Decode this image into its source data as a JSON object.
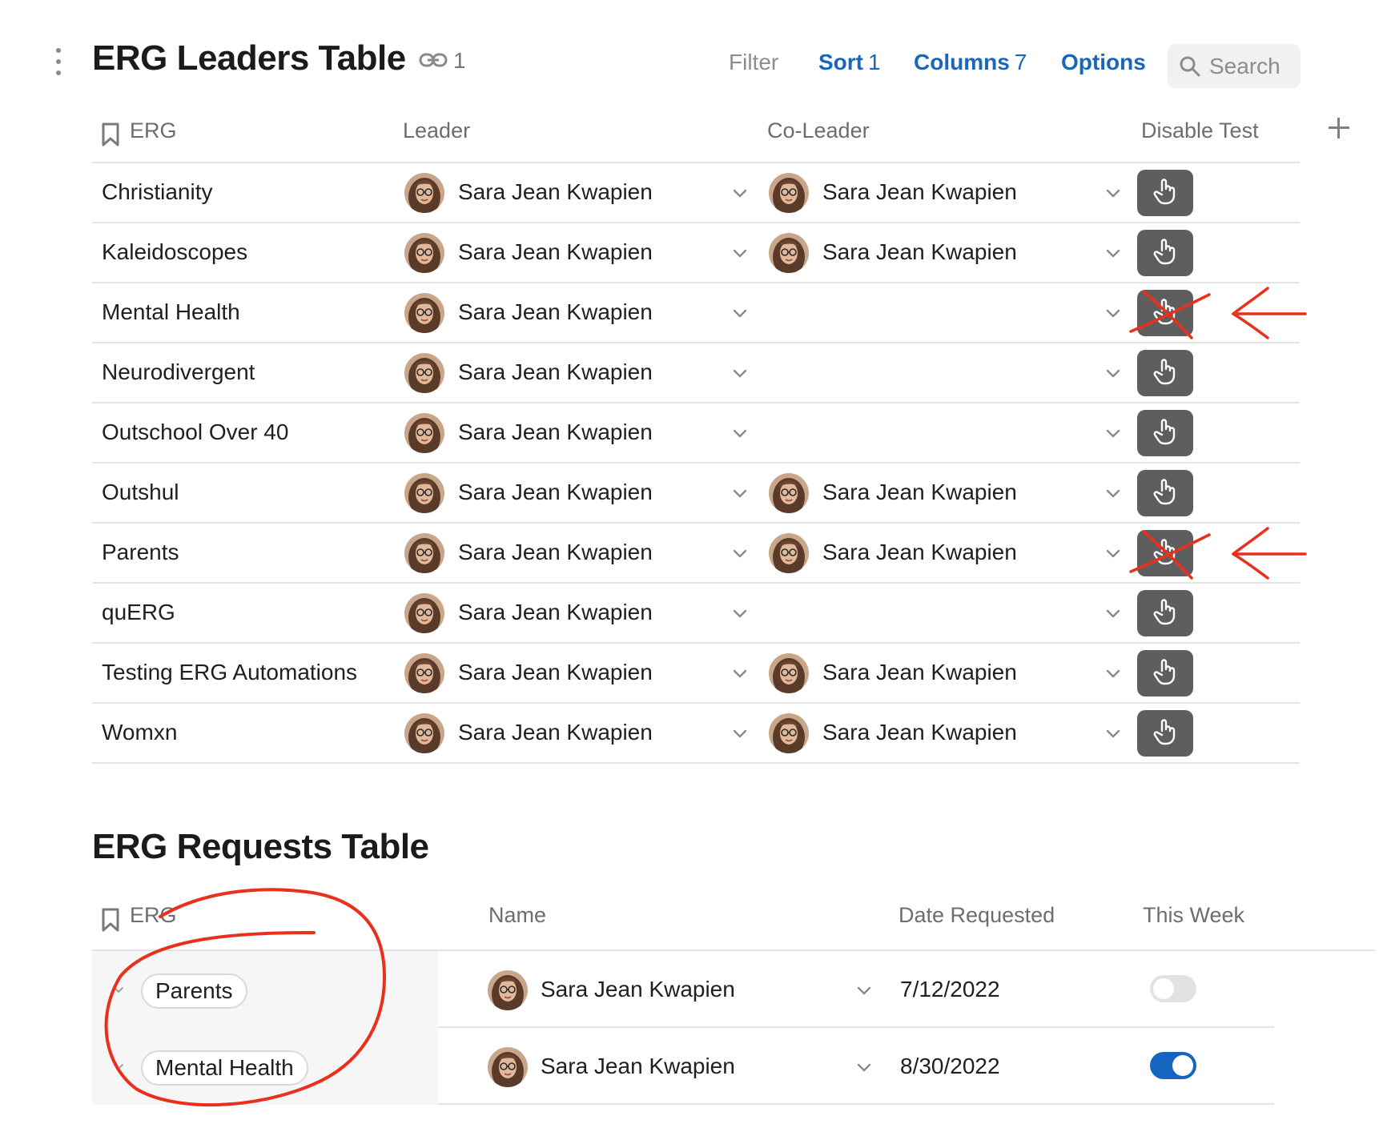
{
  "leaders_table": {
    "title": "ERG Leaders Table",
    "link_count": "1",
    "toolbar": {
      "filter": "Filter",
      "sort": "Sort",
      "sort_count": "1",
      "columns": "Columns",
      "columns_count": "7",
      "options": "Options",
      "search_placeholder": "Search"
    },
    "columns": [
      "ERG",
      "Leader",
      "Co-Leader",
      "Disable Test"
    ],
    "rows": [
      {
        "erg": "Christianity",
        "leader": "Sara Jean Kwapien",
        "co_leader": "Sara Jean Kwapien",
        "crossed_out": false
      },
      {
        "erg": "Kaleidoscopes",
        "leader": "Sara Jean Kwapien",
        "co_leader": "Sara Jean Kwapien",
        "crossed_out": false
      },
      {
        "erg": "Mental Health",
        "leader": "Sara Jean Kwapien",
        "co_leader": "",
        "crossed_out": true
      },
      {
        "erg": "Neurodivergent",
        "leader": "Sara Jean Kwapien",
        "co_leader": "",
        "crossed_out": false
      },
      {
        "erg": "Outschool Over 40",
        "leader": "Sara Jean Kwapien",
        "co_leader": "",
        "crossed_out": false
      },
      {
        "erg": "Outshul",
        "leader": "Sara Jean Kwapien",
        "co_leader": "Sara Jean Kwapien",
        "crossed_out": false
      },
      {
        "erg": "Parents",
        "leader": "Sara Jean Kwapien",
        "co_leader": "Sara Jean Kwapien",
        "crossed_out": true
      },
      {
        "erg": "quERG",
        "leader": "Sara Jean Kwapien",
        "co_leader": "",
        "crossed_out": false
      },
      {
        "erg": "Testing ERG Automations",
        "leader": "Sara Jean Kwapien",
        "co_leader": "Sara Jean Kwapien",
        "crossed_out": false
      },
      {
        "erg": "Womxn",
        "leader": "Sara Jean Kwapien",
        "co_leader": "Sara Jean Kwapien",
        "crossed_out": false
      }
    ]
  },
  "requests_table": {
    "title": "ERG Requests Table",
    "columns": [
      "ERG",
      "Name",
      "Date Requested",
      "This Week"
    ],
    "rows": [
      {
        "erg": "Parents",
        "name": "Sara Jean Kwapien",
        "date_requested": "7/12/2022",
        "this_week": false
      },
      {
        "erg": "Mental Health",
        "name": "Sara Jean Kwapien",
        "date_requested": "8/30/2022",
        "this_week": true
      }
    ]
  },
  "colors": {
    "accent_blue": "#1a66b8",
    "toggle_on": "#1565c0",
    "button_dark": "#5e5e5e",
    "annotation_red": "#e8301c"
  },
  "icons": [
    "kebab-menu-icon",
    "link-icon",
    "search-icon",
    "bookmark-icon",
    "plus-icon",
    "chevron-down-icon",
    "hand-pointer-icon"
  ]
}
